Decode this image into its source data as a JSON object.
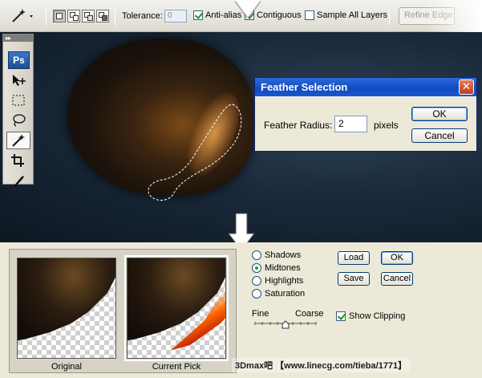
{
  "options_bar": {
    "tolerance_label": "Tolerance:",
    "tolerance_value": "0",
    "anti_alias_label": "Anti-alias",
    "anti_alias_checked": true,
    "contiguous_label": "Contiguous",
    "contiguous_checked": true,
    "sample_all_layers_label": "Sample All Layers",
    "sample_all_layers_checked": false,
    "refine_edge_label": "Refine Edge..."
  },
  "toolbox": {
    "logo": "Ps",
    "grip": "▸▸"
  },
  "feather_dialog": {
    "title": "Feather Selection",
    "close_glyph": "✕",
    "radius_label": "Feather Radius:",
    "radius_value": "2",
    "unit_label": "pixels",
    "ok_label": "OK",
    "cancel_label": "Cancel"
  },
  "color_range_panel": {
    "thumb_original_label": "Original",
    "thumb_current_label": "Current Pick",
    "ranges": [
      {
        "label": "Shadows",
        "selected": false
      },
      {
        "label": "Midtones",
        "selected": true
      },
      {
        "label": "Highlights",
        "selected": false
      },
      {
        "label": "Saturation",
        "selected": false
      }
    ],
    "load_label": "Load",
    "ok_label": "OK",
    "save_label": "Save",
    "cancel_label": "Cancel",
    "fine_label": "Fine",
    "coarse_label": "Coarse",
    "slider_position": 0.5,
    "show_clipping_label": "Show Clipping",
    "show_clipping_checked": true
  },
  "watermark": "3Dmax吧 【www.linecg.com/tieba/1771】",
  "colors": {
    "dialog_title": "#0f4ac2",
    "panel_bg": "#ece9d8",
    "canvas_bg": "#1a2a3b"
  }
}
